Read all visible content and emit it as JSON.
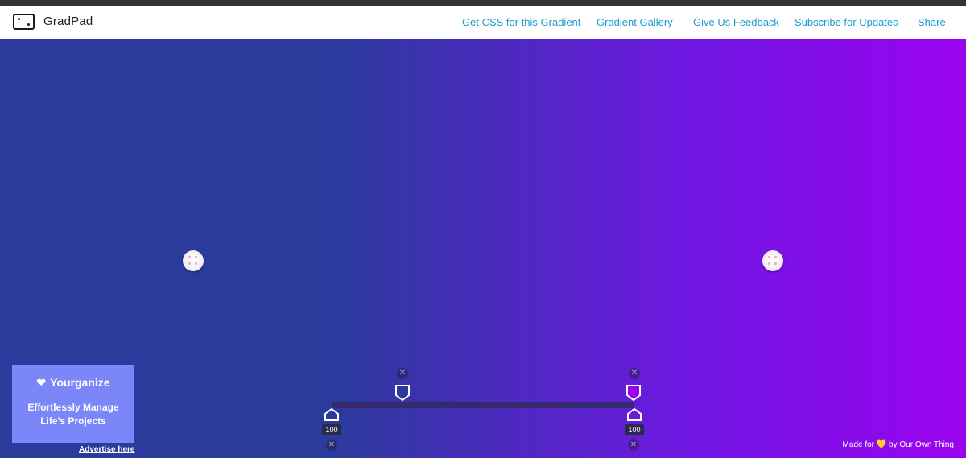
{
  "app": {
    "name": "GradPad",
    "logo_icon": "gradpad-frame-icon"
  },
  "nav": [
    {
      "label": "Get CSS for this Gradient"
    },
    {
      "label": "Gradient Gallery"
    },
    {
      "label": "Give Us Feedback"
    },
    {
      "label": "Subscribe for Updates"
    },
    {
      "label": "Share"
    }
  ],
  "colors": {
    "nav_link": "#1a9bd0",
    "gradient_start": "#2a3b9b",
    "gradient_end": "#9a03ef",
    "ad_background": "#7b86f8"
  },
  "ad": {
    "brand": "Yourganize",
    "brand_icon": "heart-leaf-icon",
    "tagline": "Effortlessly Manage Life’s Projects",
    "advertise_link": "Advertise here"
  },
  "gradient_editor": {
    "stops": [
      {
        "opacity": "100",
        "color": "#2a3b9b"
      },
      {
        "opacity": "100",
        "color": "#9a03ef"
      }
    ]
  },
  "footer": {
    "made_for": "Made for",
    "heart_icon": "heart-emoji-icon",
    "by": "by",
    "link": "Our Own Thing"
  }
}
